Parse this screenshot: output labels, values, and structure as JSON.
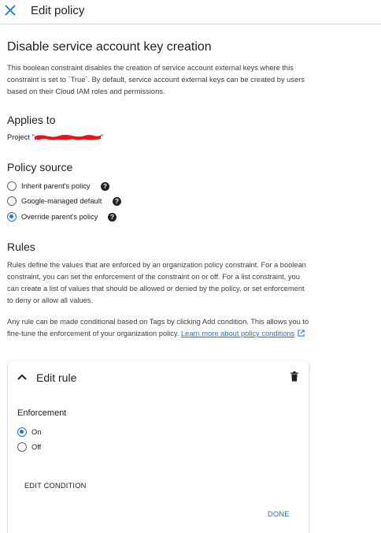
{
  "header": {
    "close_icon": "close-icon",
    "title": "Edit policy"
  },
  "policy": {
    "title": "Disable service account key creation",
    "description": "This boolean constraint disables the creation of service account external keys where this constraint is set to `True`. By default, service account external keys can be created by users based on their Cloud IAM roles and permissions."
  },
  "applies_to": {
    "heading": "Applies to",
    "project_label": "Project \"",
    "project_suffix": "\""
  },
  "policy_source": {
    "heading": "Policy source",
    "options": [
      {
        "label": "Inherit parent's policy",
        "checked": false
      },
      {
        "label": "Google-managed default",
        "checked": false
      },
      {
        "label": "Override parent's policy",
        "checked": true
      }
    ],
    "help_icon": "help-icon",
    "help_glyph": "?"
  },
  "rules": {
    "heading": "Rules",
    "description": "Rules define the values that are enforced by an organization policy constraint. For a boolean constraint, you can set the enforcement of the constraint on or off. For a list constraint, you can create a list of values that should be allowed or denied by the policy, or set enforcement to deny or allow all values.",
    "conditional_text": "Any rule can be made conditional based on Tags by clicking Add condition. This allows you to fine-tune the enforcement of your organization policy. ",
    "learn_more": "Learn more about policy conditions"
  },
  "edit_rule": {
    "title": "Edit rule",
    "enforcement_heading": "Enforcement",
    "options": [
      {
        "label": "On",
        "checked": true
      },
      {
        "label": "Off",
        "checked": false
      }
    ],
    "edit_condition": "EDIT CONDITION",
    "done": "DONE"
  },
  "colors": {
    "accent": "#1a73e8",
    "text": "#202124",
    "redaction": "#e8141a"
  }
}
